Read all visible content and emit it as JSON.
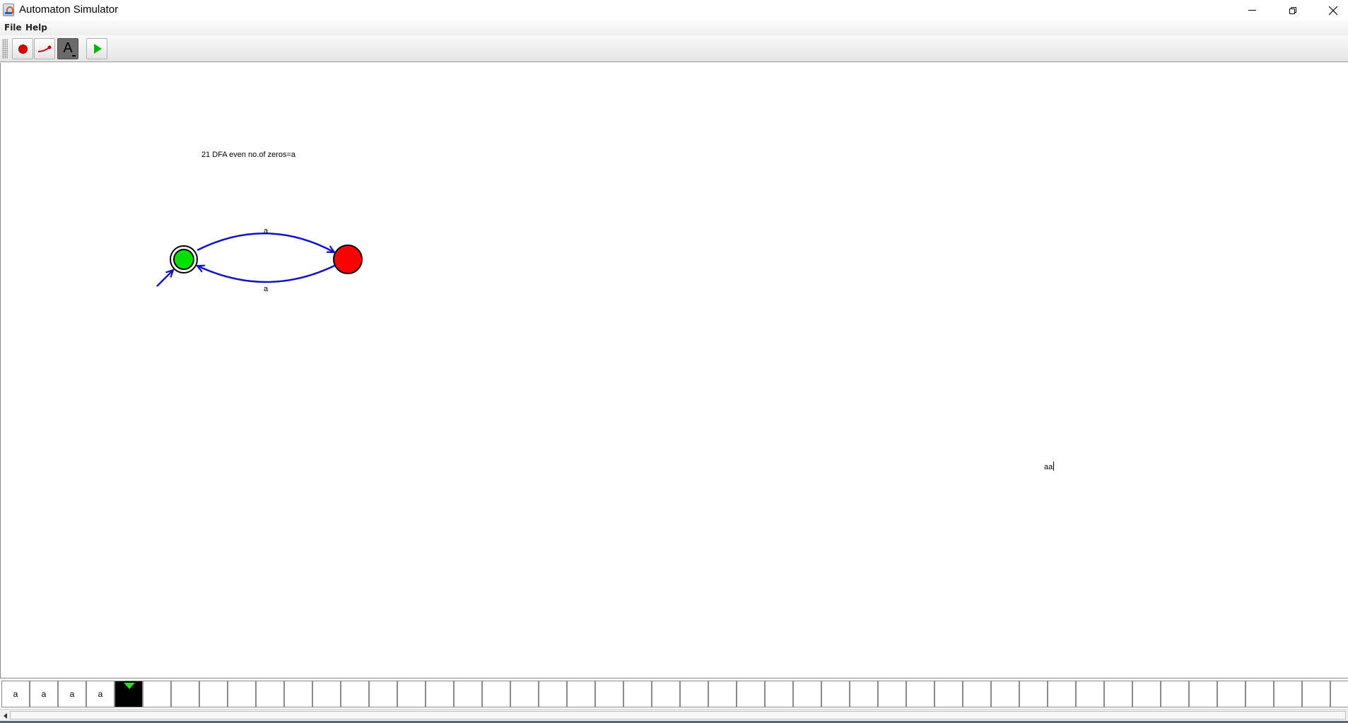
{
  "window": {
    "title": "Automaton Simulator",
    "controls": {
      "minimize": "minimize-icon",
      "restore": "restore-icon",
      "close": "close-icon"
    }
  },
  "menu": {
    "file": "File",
    "help": "Help"
  },
  "toolbar": {
    "tools": [
      {
        "name": "state-tool",
        "icon": "red-circle-icon"
      },
      {
        "name": "transition-tool",
        "icon": "transition-arrow-icon"
      },
      {
        "name": "text-tool",
        "icon": "text-A-icon",
        "label": "A",
        "selected": true
      },
      {
        "name": "run-tool",
        "icon": "play-icon"
      }
    ]
  },
  "canvas": {
    "automaton_title": "21 DFA even no.of zeros=a",
    "free_text": "aa",
    "colors": {
      "accepting_start_state": "#00e000",
      "other_state": "#ff0000",
      "transition": "#1010c8"
    },
    "states": [
      {
        "id": "q0",
        "start": true,
        "accepting": true
      },
      {
        "id": "q1",
        "start": false,
        "accepting": false
      }
    ],
    "transitions": [
      {
        "from": "q0",
        "to": "q1",
        "label": "a"
      },
      {
        "from": "q1",
        "to": "q0",
        "label": "a"
      }
    ]
  },
  "tape": {
    "symbols": [
      "a",
      "a",
      "a",
      "a",
      "",
      "",
      "",
      "",
      "",
      "",
      "",
      "",
      "",
      "",
      "",
      "",
      "",
      "",
      "",
      "",
      "",
      "",
      "",
      "",
      "",
      "",
      "",
      "",
      "",
      "",
      "",
      "",
      "",
      "",
      "",
      "",
      "",
      "",
      "",
      "",
      "",
      "",
      "",
      "",
      "",
      "",
      "",
      ""
    ],
    "head_index": 4,
    "head_color": "#22e022"
  }
}
